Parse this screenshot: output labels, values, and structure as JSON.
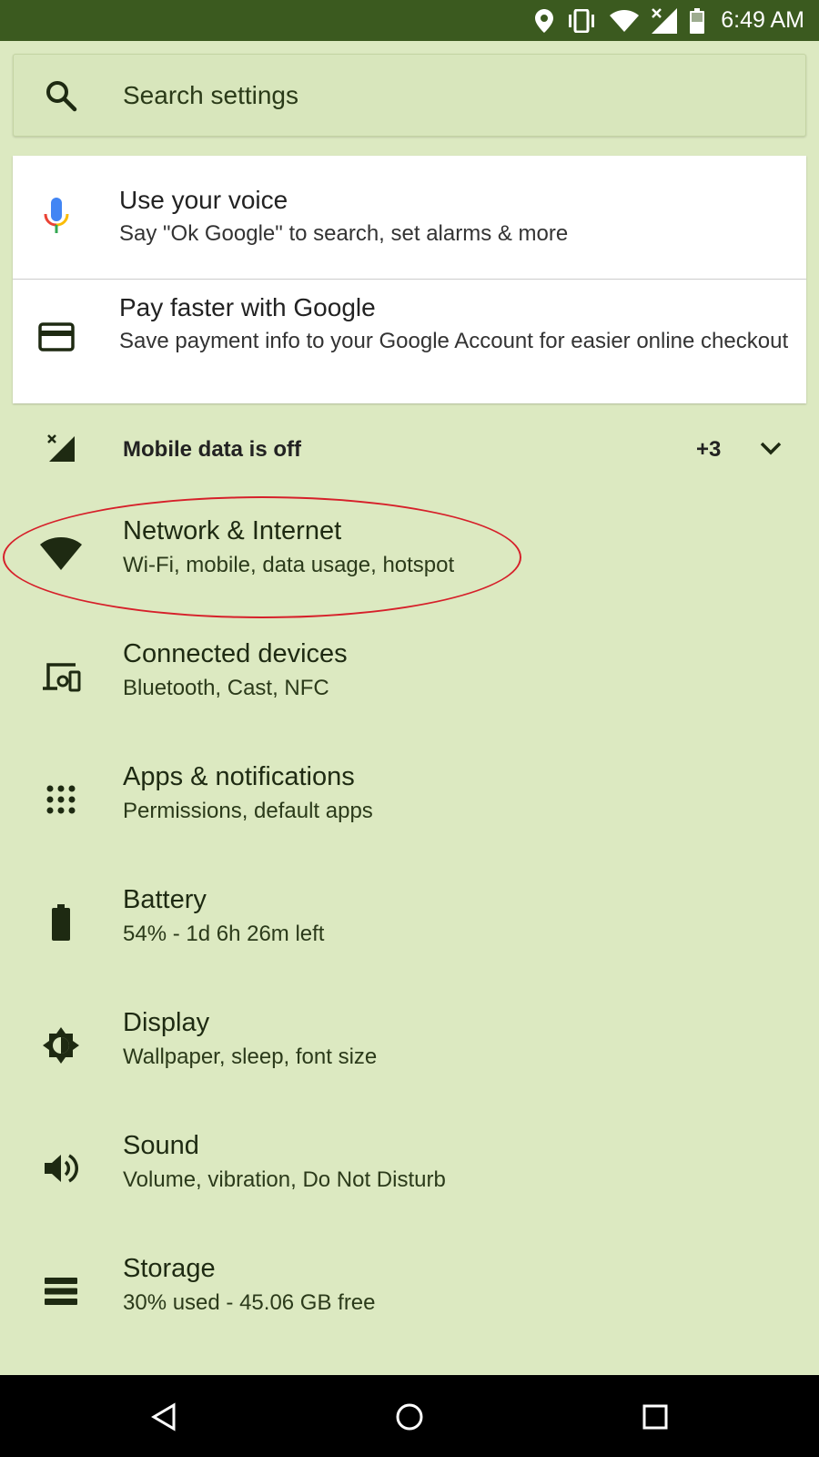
{
  "status_bar": {
    "time": "6:49 AM",
    "icons": [
      "location-icon",
      "vibrate-icon",
      "wifi-icon",
      "signal-off-icon",
      "battery-icon"
    ]
  },
  "search": {
    "placeholder": "Search settings",
    "icon": "search-icon"
  },
  "suggestions": [
    {
      "title": "Use your voice",
      "subtitle": "Say \"Ok Google\" to search, set alarms & more",
      "icon": "microphone-icon"
    },
    {
      "title": "Pay faster with Google",
      "subtitle": "Save payment info to your Google Account for easier online checkout",
      "icon": "credit-card-icon"
    }
  ],
  "condition": {
    "text": "Mobile data is off",
    "count": "+3",
    "icon": "signal-off-icon"
  },
  "settings": [
    {
      "title": "Network & Internet",
      "subtitle": "Wi-Fi, mobile, data usage, hotspot",
      "icon": "wifi-icon"
    },
    {
      "title": "Connected devices",
      "subtitle": "Bluetooth, Cast, NFC",
      "icon": "devices-icon"
    },
    {
      "title": "Apps & notifications",
      "subtitle": "Permissions, default apps",
      "icon": "apps-grid-icon"
    },
    {
      "title": "Battery",
      "subtitle": "54% - 1d 6h 26m left",
      "icon": "battery-icon"
    },
    {
      "title": "Display",
      "subtitle": "Wallpaper, sleep, font size",
      "icon": "brightness-icon"
    },
    {
      "title": "Sound",
      "subtitle": "Volume, vibration, Do Not Disturb",
      "icon": "volume-icon"
    },
    {
      "title": "Storage",
      "subtitle": "30% used - 45.06 GB free",
      "icon": "storage-icon"
    }
  ],
  "nav_bar": [
    "back-icon",
    "home-icon",
    "recents-icon"
  ],
  "colors": {
    "status_bar": "#3b5a1f",
    "background": "#dce9c1",
    "highlight_ring": "#d6202a",
    "icon": "#1e2a12"
  }
}
